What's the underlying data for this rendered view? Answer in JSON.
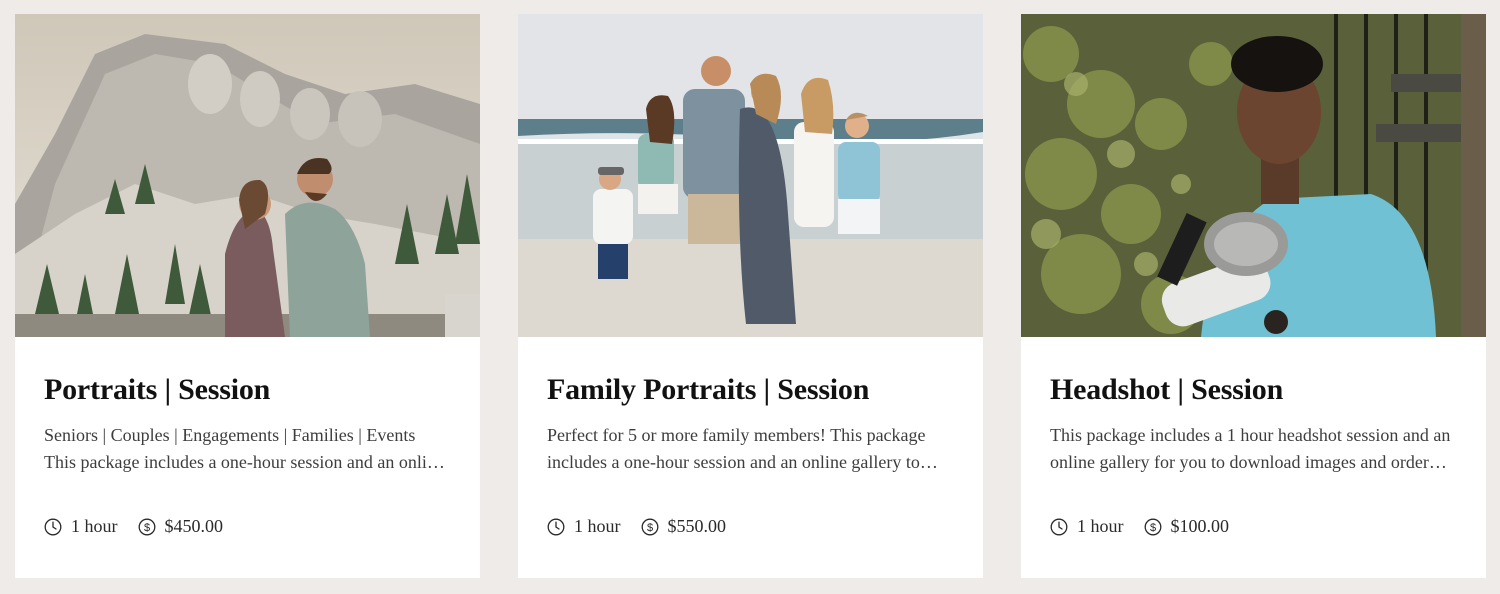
{
  "cards": [
    {
      "title": "Portraits | Session",
      "description": "Seniors | Couples | Engagements | Families | Events This package includes a one-hour session and an online gallery to download and share your images.",
      "duration": "1 hour",
      "price": "$450.00",
      "duration_icon": "clock-icon",
      "price_icon": "dollar-circle-icon"
    },
    {
      "title": "Family Portraits | Session",
      "description": "Perfect for 5 or more family members! This package includes a one-hour session and an online gallery to download and share your images.",
      "duration": "1 hour",
      "price": "$550.00",
      "duration_icon": "clock-icon",
      "price_icon": "dollar-circle-icon"
    },
    {
      "title": "Headshot | Session",
      "description": "This package includes a 1 hour headshot session and an online gallery for you to download images and order prints.",
      "duration": "1 hour",
      "price": "$100.00",
      "duration_icon": "clock-icon",
      "price_icon": "dollar-circle-icon"
    }
  ]
}
